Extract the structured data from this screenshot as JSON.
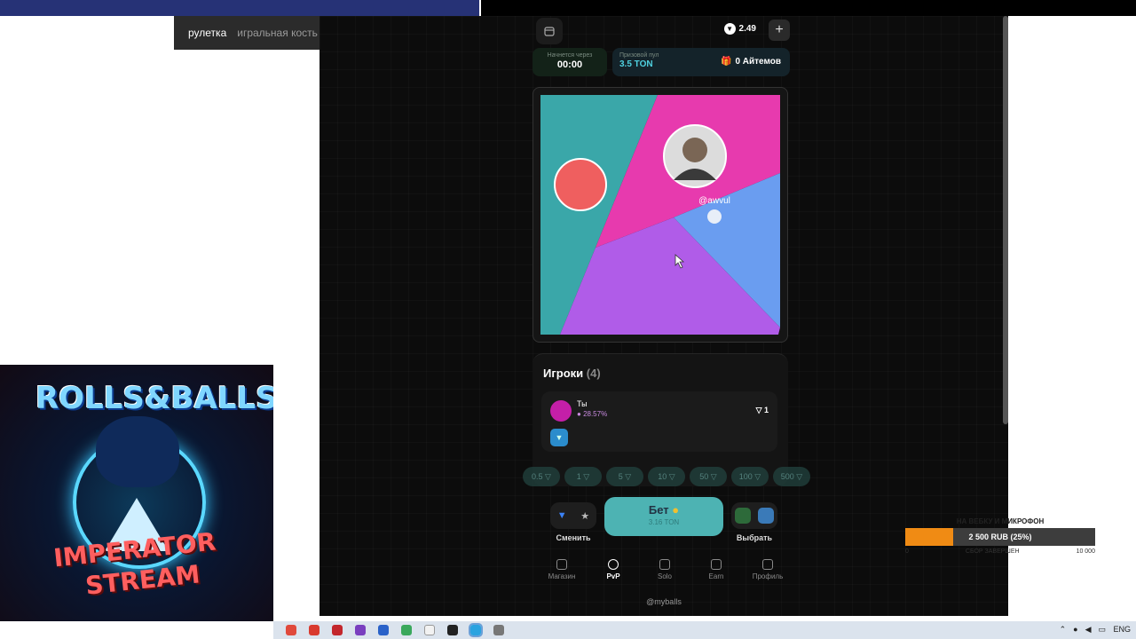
{
  "browser": {
    "tabs": [
      {
        "label": "рулетка",
        "active": true
      },
      {
        "label": "игральная кость",
        "active": false
      }
    ]
  },
  "header": {
    "balance": "2.49",
    "add_icon": "plus-icon",
    "calendar_icon": "calendar-icon"
  },
  "round": {
    "starts_label": "Начнется через",
    "timer": "00:00",
    "pool_label": "Призовой пул",
    "pool_value": "3.5 TON",
    "items": "0 Айтемов"
  },
  "wheel": {
    "player_tag": "@awvul",
    "colors": [
      "#3aa7a9",
      "#e73aae",
      "#6a9df0",
      "#b05ce8"
    ]
  },
  "players": {
    "title": "Игроки",
    "count": "(4)",
    "list": [
      {
        "name": "Ты",
        "percent": "28.57%",
        "bet": "1",
        "color": "#c41fa8"
      }
    ]
  },
  "bet_amounts": [
    "0.5",
    "1",
    "5",
    "10",
    "50",
    "100",
    "500"
  ],
  "actions": {
    "switch_label": "Сменить",
    "bet_label": "Бет",
    "bet_sub": "3.16 TON",
    "choose_label": "Выбрать"
  },
  "nav": [
    {
      "label": "Магазин",
      "icon": "shop-icon",
      "active": false
    },
    {
      "label": "PvP",
      "icon": "pvp-icon",
      "active": true
    },
    {
      "label": "Solo",
      "icon": "gear-icon",
      "active": false
    },
    {
      "label": "Earn",
      "icon": "star-icon",
      "active": false
    },
    {
      "label": "Профиль",
      "icon": "user-icon",
      "active": false
    }
  ],
  "footer": "@myballs",
  "stream_art": {
    "line1": "ROLLS&BALLS",
    "line2": "IMPERATOR",
    "line3": "STREAM"
  },
  "donation": {
    "title": "НА ВЕБКУ И МИКРОФОН",
    "progress_text": "2 500 RUB (25%)",
    "progress": 0.25,
    "min": "0",
    "status": "СБОР ЗАВЕРШЕН",
    "max": "10 000"
  },
  "taskbar": {
    "lang": "ENG"
  }
}
